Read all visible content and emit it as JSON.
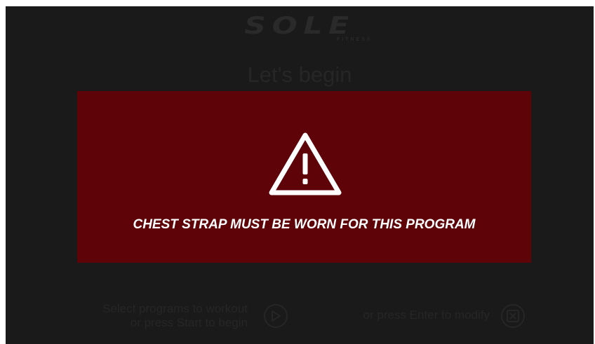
{
  "brand": {
    "logo_text": "SOLE",
    "logo_sub": "FITNESS"
  },
  "background_screen": {
    "heading": "Let's begin",
    "hint_left_line1": "Select programs to workout",
    "hint_left_line2": "or press Start to begin",
    "hint_right": "or press Enter to modify",
    "play_icon": "play-icon",
    "close_icon": "close-icon"
  },
  "alert": {
    "icon": "warning-triangle-icon",
    "message": "CHEST STRAP MUST BE WORN FOR THIS PROGRAM",
    "background_color": "#5e0308",
    "text_color": "#ffffff"
  },
  "colors": {
    "screen_background": "#1a1a1a",
    "dimmed_text": "#262626"
  }
}
